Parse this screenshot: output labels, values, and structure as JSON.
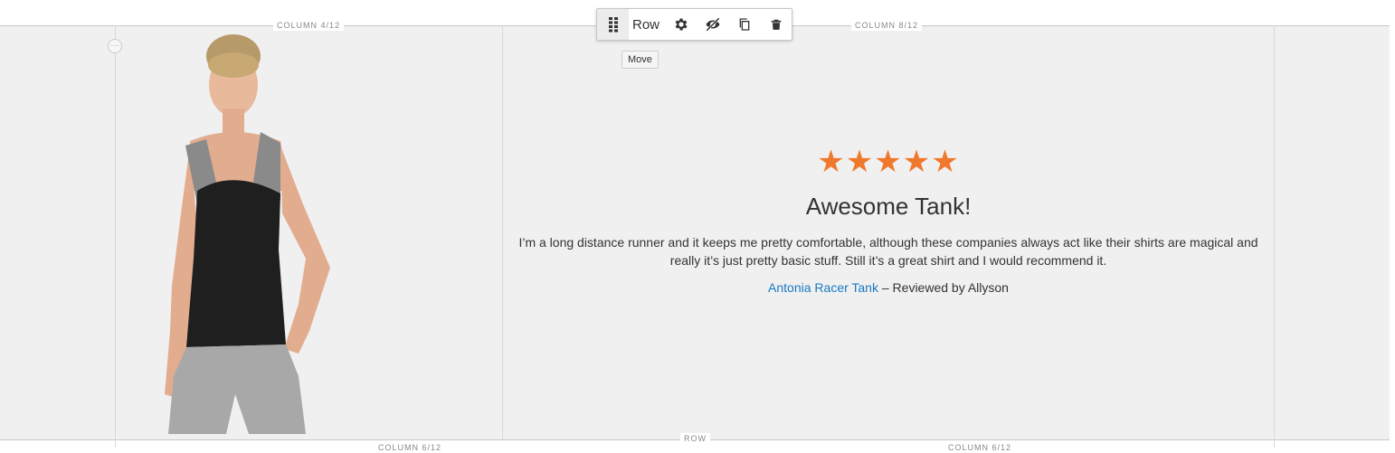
{
  "columns": {
    "left_label": "COLUMN 4/12",
    "right_label": "COLUMN 8/12",
    "bottom_left_label": "COLUMN 6/12",
    "bottom_right_label": "COLUMN 6/12"
  },
  "row_label": "ROW",
  "toolbar": {
    "move_icon": "drag-handle-icon",
    "label": "Row",
    "settings_icon": "gear-icon",
    "hide_icon": "eye-slash-icon",
    "duplicate_icon": "copy-icon",
    "remove_icon": "trash-icon",
    "tooltip": "Move"
  },
  "review": {
    "stars": "★★★★★",
    "rating": 5,
    "title": "Awesome Tank!",
    "text": "I’m a long distance runner and it keeps me pretty comfortable, although these companies always act like their shirts are magical and really it’s just pretty basic stuff. Still it’s a great shirt and I would recommend it.",
    "product_link": "Antonia Racer Tank",
    "reviewer": " – Reviewed by Allyson"
  },
  "colors": {
    "star": "#f0782d",
    "link": "#1979c3",
    "stage_bg": "#f0f0f0"
  }
}
